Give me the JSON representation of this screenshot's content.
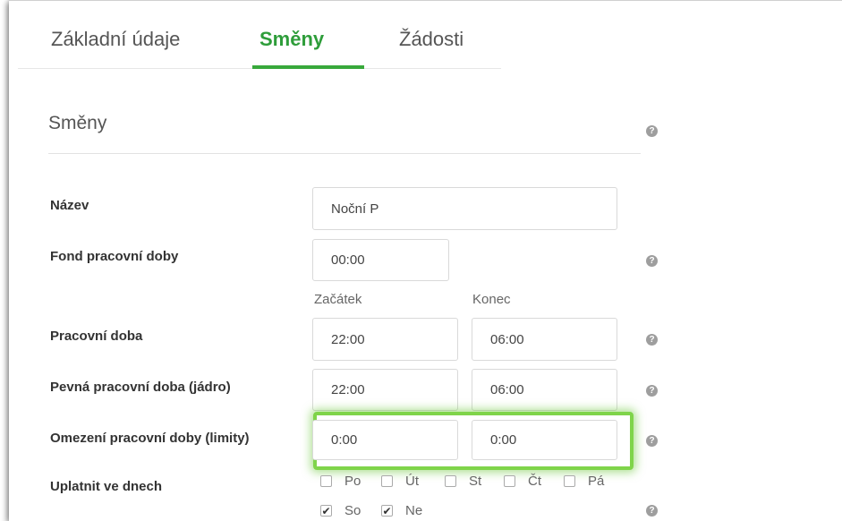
{
  "tabs": [
    {
      "label": "Základní údaje",
      "active": false
    },
    {
      "label": "Směny",
      "active": true
    },
    {
      "label": "Žádosti",
      "active": false
    }
  ],
  "section": {
    "title": "Směny"
  },
  "form": {
    "name": {
      "label": "Název",
      "value": "Noční P"
    },
    "fund": {
      "label": "Fond pracovní doby",
      "value": "00:00"
    },
    "columns": {
      "start": "Začátek",
      "end": "Konec"
    },
    "working_time": {
      "label": "Pracovní doba",
      "start": "22:00",
      "end": "06:00"
    },
    "core_time": {
      "label": "Pevná pracovní doba (jádro)",
      "start": "22:00",
      "end": "06:00"
    },
    "limits": {
      "label": "Omezení pracovní doby (limity)",
      "start": "0:00",
      "end": "0:00"
    },
    "days": {
      "label": "Uplatnit ve dnech",
      "items": [
        {
          "label": "Po",
          "checked": false
        },
        {
          "label": "Út",
          "checked": false
        },
        {
          "label": "St",
          "checked": false
        },
        {
          "label": "Čt",
          "checked": false
        },
        {
          "label": "Pá",
          "checked": false
        },
        {
          "label": "So",
          "checked": true
        },
        {
          "label": "Ne",
          "checked": true
        }
      ]
    }
  },
  "icons": {
    "help": "question-circle-icon",
    "check": "✔"
  },
  "colors": {
    "accent": "#38a93b",
    "highlight": "#7fd44a"
  }
}
